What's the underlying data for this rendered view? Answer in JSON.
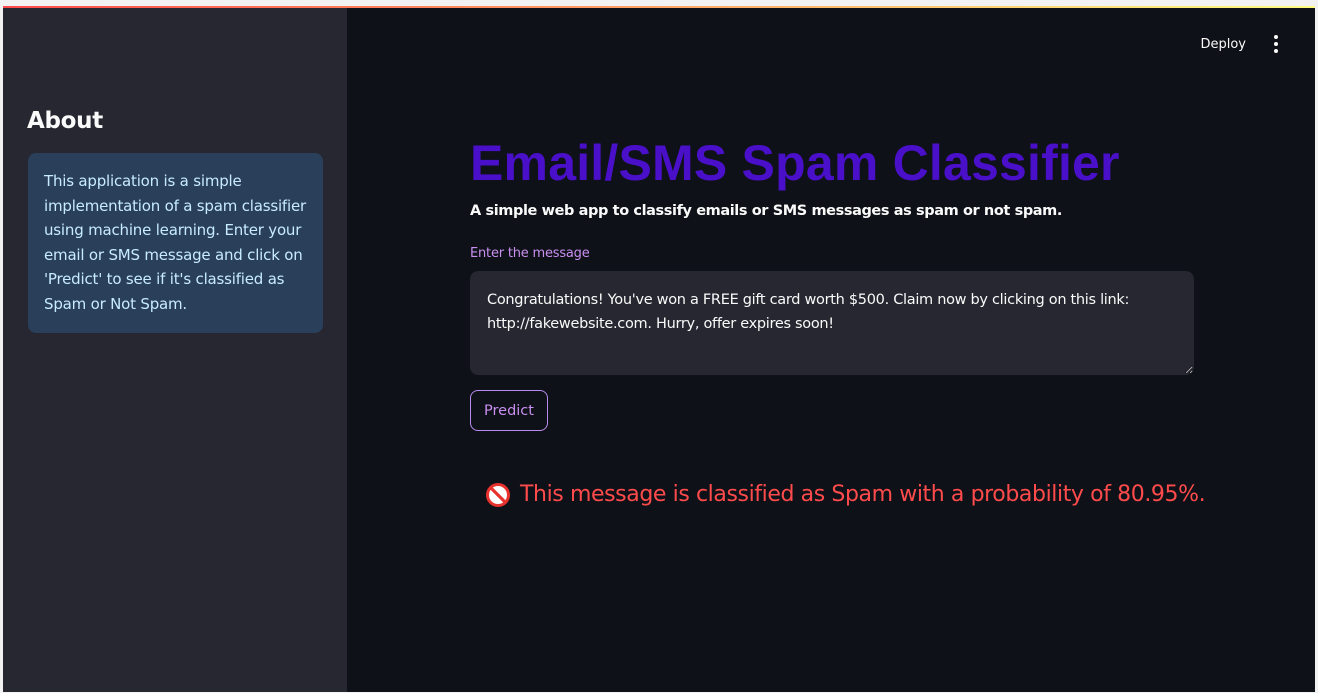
{
  "toolbar": {
    "deploy_label": "Deploy",
    "menu_icon": "more-vertical-icon"
  },
  "sidebar": {
    "heading": "About",
    "info_text": "This application is a simple implementation of a spam classifier using machine learning. Enter your email or SMS message and click on 'Predict' to see if it's classified as Spam or Not Spam."
  },
  "main": {
    "title": "Email/SMS Spam Classifier",
    "subtitle": "A simple web app to classify emails or SMS messages as spam or not spam.",
    "input_label": "Enter the message",
    "input_value": "Congratulations! You've won a FREE gift card worth $500. Claim now by clicking on this link: http://fakewebsite.com. Hurry, offer expires soon!",
    "predict_label": "Predict",
    "result_icon": "no-entry-icon",
    "result_text": "This message is classified as Spam with a probability of 80.95%."
  },
  "colors": {
    "background": "#0e1117",
    "sidebar": "#262730",
    "info_box": "#2a3f5a",
    "title": "#4a0fc9",
    "accent": "#c98ff0",
    "error": "#ff4b4b"
  }
}
